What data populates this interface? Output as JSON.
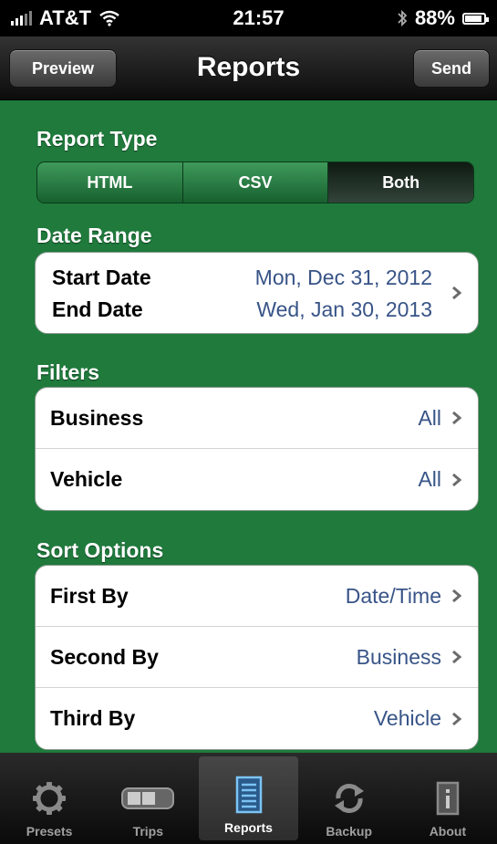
{
  "status_bar": {
    "carrier": "AT&T",
    "time": "21:57",
    "battery": "88%",
    "battery_level": 0.88
  },
  "nav": {
    "title": "Reports",
    "left_button": "Preview",
    "right_button": "Send"
  },
  "report_type": {
    "header": "Report Type",
    "options": [
      "HTML",
      "CSV",
      "Both"
    ],
    "selected": "Both"
  },
  "date_range": {
    "header": "Date Range",
    "start_label": "Start Date",
    "start_value": "Mon, Dec 31, 2012",
    "end_label": "End Date",
    "end_value": "Wed, Jan 30, 2013"
  },
  "filters": {
    "header": "Filters",
    "rows": [
      {
        "label": "Business",
        "value": "All"
      },
      {
        "label": "Vehicle",
        "value": "All"
      }
    ]
  },
  "sort_options": {
    "header": "Sort Options",
    "rows": [
      {
        "label": "First By",
        "value": "Date/Time"
      },
      {
        "label": "Second By",
        "value": "Business"
      },
      {
        "label": "Third By",
        "value": "Vehicle"
      }
    ]
  },
  "tab_bar": {
    "items": [
      {
        "label": "Presets",
        "icon": "gear-icon"
      },
      {
        "label": "Trips",
        "icon": "toggle-icon"
      },
      {
        "label": "Reports",
        "icon": "document-icon"
      },
      {
        "label": "Backup",
        "icon": "sync-icon"
      },
      {
        "label": "About",
        "icon": "info-icon"
      }
    ],
    "active": "Reports"
  }
}
